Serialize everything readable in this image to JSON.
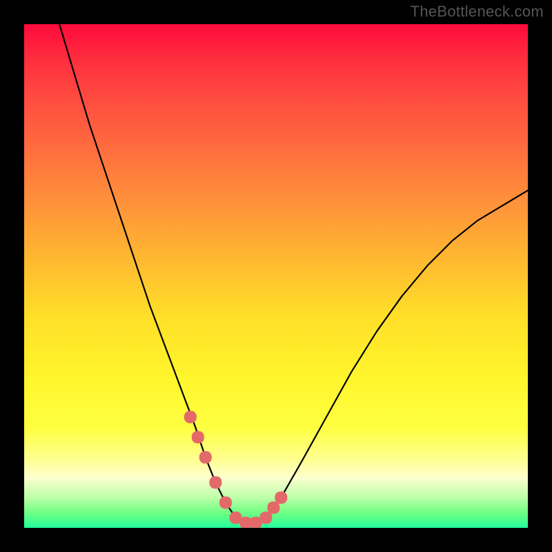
{
  "watermark": "TheBottleneck.com",
  "colors": {
    "background": "#000000",
    "curve": "#000000",
    "highlight": "#e46a6a",
    "watermark": "#555555"
  },
  "chart_data": {
    "type": "line",
    "title": "",
    "xlabel": "",
    "ylabel": "",
    "xlim": [
      0,
      100
    ],
    "ylim": [
      0,
      100
    ],
    "series": [
      {
        "name": "bottleneck-curve",
        "x": [
          7,
          10,
          13,
          16,
          19,
          22,
          25,
          28,
          31,
          34,
          36,
          38,
          40,
          42,
          44,
          46,
          48,
          51,
          55,
          60,
          65,
          70,
          75,
          80,
          85,
          90,
          95,
          100
        ],
        "y": [
          100,
          90,
          80,
          71,
          62,
          53,
          44,
          36,
          28,
          20,
          14,
          9,
          5,
          2,
          1,
          1,
          2,
          6,
          13,
          22,
          31,
          39,
          46,
          52,
          57,
          61,
          64,
          67
        ]
      }
    ],
    "highlight_points": {
      "name": "near-minimum-markers",
      "x": [
        33,
        34.5,
        36,
        38,
        40,
        42,
        44,
        46,
        48,
        49.5,
        51
      ],
      "y": [
        22,
        18,
        14,
        9,
        5,
        2,
        1,
        1,
        2,
        4,
        6
      ]
    },
    "annotations": [
      {
        "text": "TheBottleneck.com",
        "role": "watermark",
        "position": "top-right"
      }
    ]
  }
}
